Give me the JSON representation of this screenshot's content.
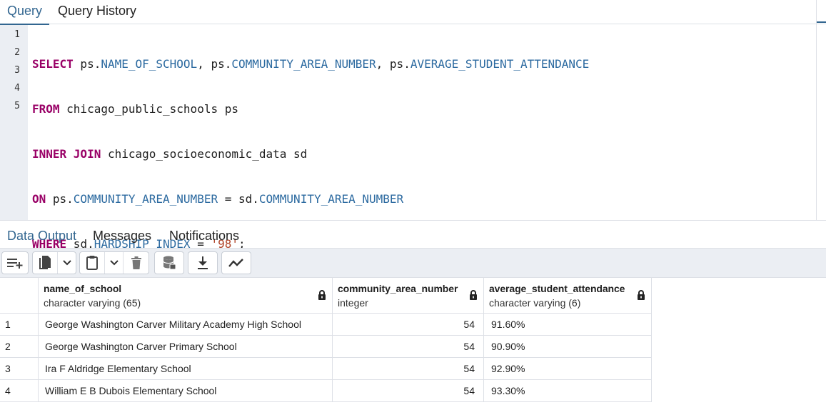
{
  "query_tabs": {
    "query": "Query",
    "history": "Query History"
  },
  "editor": {
    "line_numbers": [
      "1",
      "2",
      "3",
      "4",
      "5"
    ]
  },
  "output_tabs": {
    "data_output": "Data Output",
    "messages": "Messages",
    "notifications": "Notifications"
  },
  "toolbar": {
    "icons": [
      "add-row-icon",
      "copy-icon",
      "chevron-down-icon",
      "paste-icon",
      "chevron-down-icon",
      "delete-icon",
      "save-data-icon",
      "download-icon",
      "graph-icon"
    ]
  },
  "columns": [
    {
      "name": "name_of_school",
      "type": "character varying (65)"
    },
    {
      "name": "community_area_number",
      "type": "integer"
    },
    {
      "name": "average_student_attendance",
      "type": "character varying (6)"
    }
  ],
  "rows": [
    {
      "n": "1",
      "school": "George Washington Carver Military Academy High School",
      "area": "54",
      "attendance": "91.60%"
    },
    {
      "n": "2",
      "school": "George Washington Carver Primary School",
      "area": "54",
      "attendance": "90.90%"
    },
    {
      "n": "3",
      "school": "Ira F Aldridge Elementary School",
      "area": "54",
      "attendance": "92.90%"
    },
    {
      "n": "4",
      "school": "William E B Dubois Elementary School",
      "area": "54",
      "attendance": "93.30%"
    }
  ],
  "colors": {
    "accent": "#326690",
    "keyword": "#990066",
    "identifier": "#2c6aa0",
    "string": "#b0452a"
  }
}
